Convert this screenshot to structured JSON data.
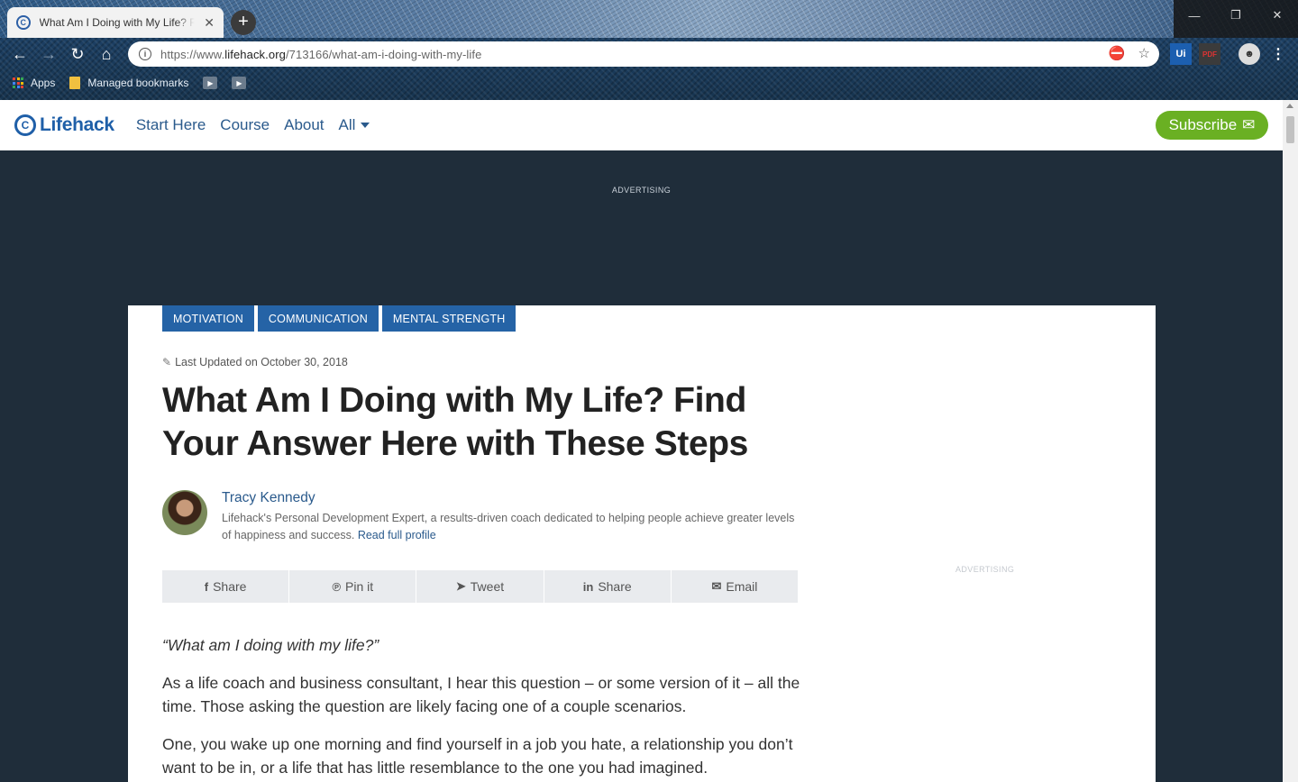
{
  "browser": {
    "tab_title": "What Am I Doing with My Life? Find Your Answer Here with These Steps",
    "tab_close": "✕",
    "new_tab": "+",
    "window_controls": {
      "minimize": "—",
      "restore": "❐",
      "close": "✕"
    },
    "url_prefix": "https://www.",
    "url_host": "lifehack.org",
    "url_path": "/713166/what-am-i-doing-with-my-life",
    "extensions": [
      "Ui",
      "PDF"
    ],
    "bookmarks": [
      {
        "label": "Apps",
        "icon": "apps-grid-icon"
      },
      {
        "label": "Managed bookmarks",
        "icon": "folder-icon"
      }
    ]
  },
  "site": {
    "logo_text": "Lifehack",
    "nav": [
      "Start Here",
      "Course",
      "About",
      "All"
    ],
    "subscribe_label": "Subscribe",
    "ad_label": "ADVERTISING"
  },
  "article": {
    "tags": [
      "MOTIVATION",
      "COMMUNICATION",
      "MENTAL STRENGTH"
    ],
    "updated": "Last Updated on October 30, 2018",
    "title": "What Am I Doing with My Life? Find Your Answer Here with These Steps",
    "author": {
      "name": "Tracy Kennedy",
      "bio": "Lifehack's Personal Development Expert, a results-driven coach dedicated to helping people achieve greater levels of happiness and success.",
      "profile_link": "Read full profile"
    },
    "share": [
      {
        "label": "Share",
        "icon": "facebook-icon",
        "glyph": "f"
      },
      {
        "label": "Pin it",
        "icon": "pinterest-icon",
        "glyph": "℗"
      },
      {
        "label": "Tweet",
        "icon": "twitter-icon",
        "glyph": "🐦"
      },
      {
        "label": "Share",
        "icon": "linkedin-icon",
        "glyph": "in"
      },
      {
        "label": "Email",
        "icon": "email-icon",
        "glyph": "✉"
      }
    ],
    "sidebar_ad_label": "ADVERTISING",
    "paragraphs": [
      "“What am I doing with my life?”",
      "As a life coach and business consultant, I hear this question – or some version of it – all the time. Those asking the question are likely facing one of a couple scenarios.",
      "One, you wake up one morning and find yourself in a job you hate, a relationship you don’t want to be in, or a life that has little resemblance to the one you had imagined."
    ]
  },
  "colors": {
    "brand_blue": "#1f5fa8",
    "tag_blue": "#2563a6",
    "subscribe_green": "#6ab023",
    "page_dark": "#1f2d3a"
  }
}
